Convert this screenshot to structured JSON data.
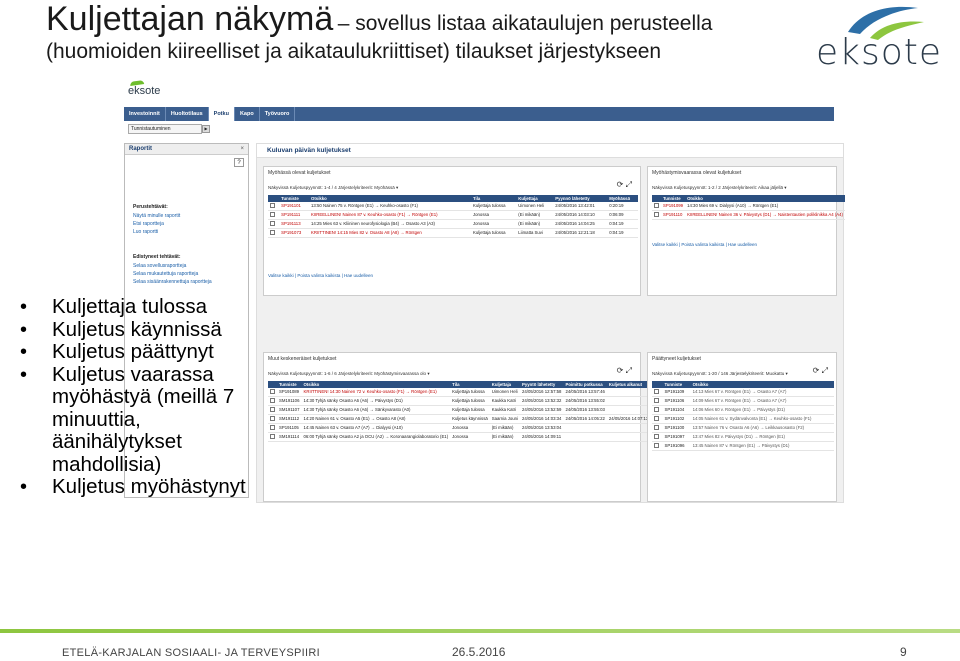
{
  "slide": {
    "title_main": "Kuljettajan näkymä",
    "title_sub": "– sovellus listaa aikataulujen perusteella",
    "title_line2": "(huomioiden kiireelliset ja aikataulukriittiset) tilaukset järjestykseen",
    "logo_text": "eksote"
  },
  "app": {
    "logo_text": "eksote",
    "nav": [
      "Investoinnit",
      "Huoltotilaus",
      "Potku",
      "Kapo",
      "Työvuoro"
    ],
    "active_nav": "Potku",
    "subbar_label": "Tunnistautuminen",
    "left_panel": {
      "title": "Raportit",
      "close": "×",
      "help": "?",
      "groups": [
        {
          "title": "Perustehtävät:",
          "items": [
            "Näytä minulle raportit",
            "Etsi raportteja",
            "Luo raportti"
          ]
        },
        {
          "title": "Edistyneet tehtävät:",
          "items": [
            "Selaa sovellusraportteja",
            "Selaa mukautettuja raportteja",
            "Selaa sisäänrakennettuja raportteja"
          ]
        }
      ]
    },
    "main_title": "Kuluvan päivän kuljetukset",
    "boxes": [
      {
        "title": "Myöhässä olevat kuljetukset",
        "filter": "Näkyvissä Kuljetuspyynnöt: 1-4 / 4     Järjestelykriteerit: Myöhässä ▾",
        "headers": [
          "",
          "Tunniste",
          "Otsikko",
          "Tila",
          "Kuljettaja",
          "Pyynnö lähetetty",
          "Myöhässä"
        ],
        "rows": [
          [
            "",
            "SP191101",
            "13:50 Nainen 75 v. Röntgen (E1) → Keuhko-osasto (F1)",
            "Kuljettaja tulossa",
            "Uimonen Heli",
            "24/05/2016 13:42:01",
            "0:20:19"
          ],
          [
            "",
            "SP191111",
            "KIIREELLINEN! Nainen 87 v. Keuhko-osasto (F1) → Röntgen (E1)",
            "Jonossa",
            "(Ei mikään)",
            "24/05/2016 14:03:10",
            "0:06:09"
          ],
          [
            "",
            "SP191113",
            "14:25 Mies 63 v. Kliininen neurofysiologia (B4) → Osasto A3 (A3)",
            "Jonossa",
            "(Ei mikään)",
            "24/05/2016 14:04:25",
            "0:04:19"
          ],
          [
            "",
            "SP191073",
            "KRIITTINEN! 14:15 Mies 82 v. Osasto A8 (A8) → Röntgen",
            "Kuljettaja tulossa",
            "Liimatta Suvi",
            "24/05/2016 12:21:18",
            "0:04:19"
          ]
        ],
        "links": "Valitse kaikki  |  Poista valinta kaikista  |  Hae uudelleen"
      },
      {
        "title": "Myöhästymisvaarassa olevat kuljetukset",
        "filter": "Näkyvissä Kuljetuspyynnöt: 1-2 / 2     Järjestelykriteerit: Aikaa jäljellä ▾",
        "headers": [
          "",
          "Tunniste",
          "Otsikko"
        ],
        "rows": [
          [
            "",
            "SP191099",
            "14:30 Mies 69 v. Dialyysi (A10) → Röntgen (E1)"
          ],
          [
            "",
            "SP191110",
            "KIIREELLINEN! Nainen 36 v. Päivystys (D1) → Naistentautien poliklinikka A4 (A4)"
          ]
        ],
        "links": "Valitse kaikki  |  Poista valinta kaikista  |  Hae uudelleen"
      },
      {
        "title": "Muut keskeneräiset kuljetukset",
        "filter": "Näkyvissä Kuljetuspyynnöt: 1-6 / 6     Järjestelykriteerit: Myöhästymisvaarassa olo ▾",
        "headers": [
          "",
          "Tunniste",
          "Otsikko",
          "Tila",
          "Kuljettaja",
          "Pyyntö lähetetty",
          "Poimittu potkussa",
          "Kuljetus alkanut"
        ],
        "rows": [
          [
            "",
            "SP191089",
            "KRIITTINEN! 14:30 Nainen 72 v. Keuhko-osasto (F1) → Röntgen (E1)",
            "Kuljettaja tulossa",
            "Uimonen Heli",
            "24/05/2016 12:57:58",
            "24/05/2016 13:57:46",
            ""
          ],
          [
            "",
            "SM191106",
            "14:30 Tyhjä sänky Osasto A6 (A6) → Päivystys (D1)",
            "Kuljettaja tulossa",
            "Kaukka Katri",
            "24/05/2016 13:52:32",
            "24/05/2016 13:55:02",
            ""
          ],
          [
            "",
            "SM191107",
            "14:30 Tyhjä sänky Osasto A6 (A6) → Sänkyvarasto (A0)",
            "Kuljettaja tulossa",
            "Kaukka Katri",
            "24/05/2016 13:52:59",
            "24/05/2016 13:55:03",
            ""
          ],
          [
            "",
            "SM191112",
            "14:20 Nainen 61 v. Osasto A5 (E1) → Osasto A8 (A8)",
            "Kuljetus käynnissä",
            "Saarnia Jouni",
            "24/05/2016 14:03:34",
            "24/05/2016 14:05:22",
            "24/05/2016 14:07:13"
          ],
          [
            "",
            "SP191105",
            "14:45 Nainen 63 v. Osasto A7 (A7) → Dialyysi (A10)",
            "Jonossa",
            "(Ei mikään)",
            "24/05/2016 13:53:04",
            "",
            ""
          ],
          [
            "",
            "SM191114",
            "06:00 Tyhjä sänky Osasto A2 ja OCU (A2) → Koronaarangiolaboratorio (E1)",
            "Jonossa",
            "(Ei mikään)",
            "24/05/2016 14:09:11",
            "",
            ""
          ]
        ]
      },
      {
        "title": "Päättyneet kuljetukset",
        "filter": "Näkyvissä Kuljetuspyynnöt: 1-20 / 146     Järjestelykriteerit: Muokattu ▾",
        "headers": [
          "",
          "Tunniste",
          "Otsikko"
        ],
        "rows": [
          [
            "",
            "SP191109",
            "14:13 Mies 67 v. Röntgen (E1) → Osasto A7 (A7)"
          ],
          [
            "",
            "SP191106",
            "14:09 Mies 67 v. Röntgen (E1) → Osasto A7 (A7)"
          ],
          [
            "",
            "SP191104",
            "14:06 Mies 60 v. Röntgen (E1) → Päivystys (D1)"
          ],
          [
            "",
            "SP191102",
            "14:05 Nainen 61 v. Sydänvalvonta (E1) → Keuhko-osasto (F1)"
          ],
          [
            "",
            "SP191100",
            "13:57 Nainen 76 v. Osasto A6 (A6) → Leikkausosasto (F2)"
          ],
          [
            "",
            "SP191097",
            "13:47 Mies 82 v. Päivystys (D1) → Röntgen (E1)"
          ],
          [
            "",
            "SP191096",
            "13:45 Nainen 87 v. Röntgen (E1) → Päivystys (D1)"
          ]
        ]
      }
    ]
  },
  "bullets": [
    "Kuljettaja tulossa",
    "Kuljetus käynnissä",
    "Kuljetus päättynyt",
    "Kuljetus vaarassa myöhästyä (meillä 7 minuuttia, äänihälytykset mahdollisia)",
    "Kuljetus myöhästynyt"
  ],
  "footer": {
    "organization": "ETELÄ-KARJALAN SOSIAALI- JA TERVEYSPIIRI",
    "date": "26.5.2016",
    "page": "9"
  },
  "colors": {
    "brand_green": "#8dc63f",
    "brand_blue": "#2b4f80",
    "nav_blue": "#3b5e8e"
  }
}
